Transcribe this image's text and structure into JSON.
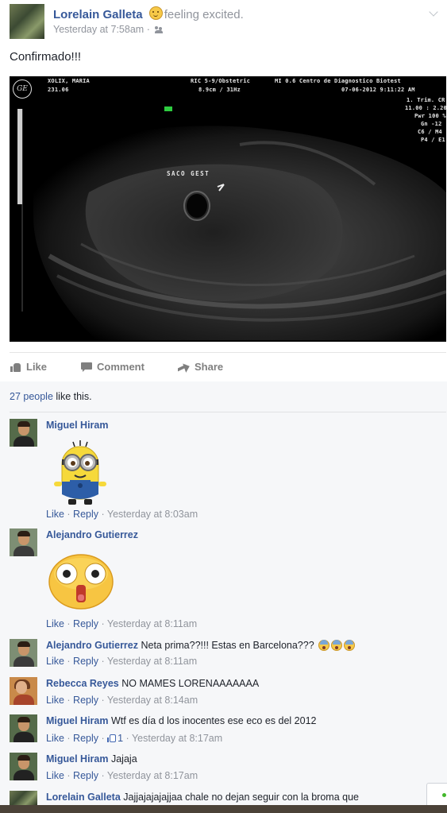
{
  "post": {
    "author": "Lorelain Galleta",
    "feeling_icon": "excited-emoji",
    "feeling": "feeling excited.",
    "timestamp": "Yesterday at 7:58am",
    "separator": "·",
    "audience_icon": "friends-icon",
    "text": "Confirmado!!!",
    "image": {
      "overlay_left_1": "XOLIX, MARIA",
      "overlay_left_2": "231.06",
      "overlay_mid_1": "RIC 5-9/Obstetric",
      "overlay_mid_2": "8.9cm / 31Hz",
      "overlay_right_1": "MI 0.6   Centro de Diagnostico Biotest",
      "overlay_right_2": "07-06-2012  9:11:22 AM",
      "overlay_side": [
        "1. Trim. CR",
        "11.00 : 2.20",
        "Pwr 100 %",
        "Gn -12",
        "C6 / M4",
        "P4 / E1"
      ],
      "label": "SACO GEST",
      "logo": "GE"
    }
  },
  "actions": {
    "like": "Like",
    "comment": "Comment",
    "share": "Share"
  },
  "likes": {
    "count_link": "27 people",
    "suffix": " like this."
  },
  "comments": [
    {
      "name": "Miguel Hiram",
      "text": "",
      "sticker": "minion-sticker",
      "like": "Like",
      "reply": "Reply",
      "time": "Yesterday at 8:03am"
    },
    {
      "name": "Alejandro Gutierrez",
      "text": "",
      "sticker": "shocked-face-sticker",
      "like": "Like",
      "reply": "Reply",
      "time": "Yesterday at 8:11am"
    },
    {
      "name": "Alejandro Gutierrez",
      "text": "Neta prima??!!! Estas en Barcelona???",
      "emoji": "scared-emoji",
      "like": "Like",
      "reply": "Reply",
      "time": "Yesterday at 8:11am"
    },
    {
      "name": "Rebecca Reyes",
      "text": "NO MAMES LORENAAAAAAA",
      "like": "Like",
      "reply": "Reply",
      "time": "Yesterday at 8:14am"
    },
    {
      "name": "Miguel Hiram",
      "text": "Wtf es día d los inocentes ese eco es del 2012",
      "like": "Like",
      "reply": "Reply",
      "likes_count": "1",
      "time": "Yesterday at 8:17am"
    },
    {
      "name": "Miguel Hiram",
      "text": "Jajaja",
      "like": "Like",
      "reply": "Reply",
      "time": "Yesterday at 8:17am"
    },
    {
      "name": "Lorelain Galleta",
      "text": "Jajjajajajajjaa chale no dejan seguir con la broma que"
    }
  ],
  "colors": {
    "link": "#365899",
    "meta": "#90949c",
    "comment_bg": "#f6f7f9",
    "online": "#42b72a"
  }
}
